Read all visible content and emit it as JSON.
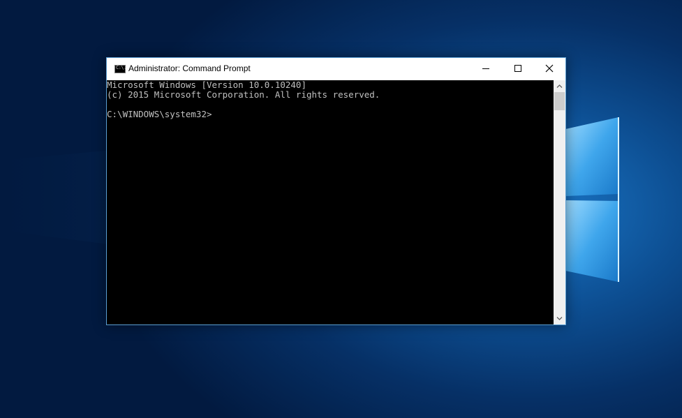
{
  "window": {
    "title": "Administrator: Command Prompt",
    "icon_label": "C:\\."
  },
  "controls": {
    "minimize_icon": "minimize-icon",
    "maximize_icon": "maximize-icon",
    "close_icon": "close-icon"
  },
  "console": {
    "lines": [
      "Microsoft Windows [Version 10.0.10240]",
      "(c) 2015 Microsoft Corporation. All rights reserved.",
      "C:\\WINDOWS\\system32>"
    ]
  },
  "colors": {
    "console_background": "#000000",
    "console_text": "#c0c0c0",
    "desktop_accent": "#1b78c9",
    "window_border": "#5a9fd4"
  }
}
